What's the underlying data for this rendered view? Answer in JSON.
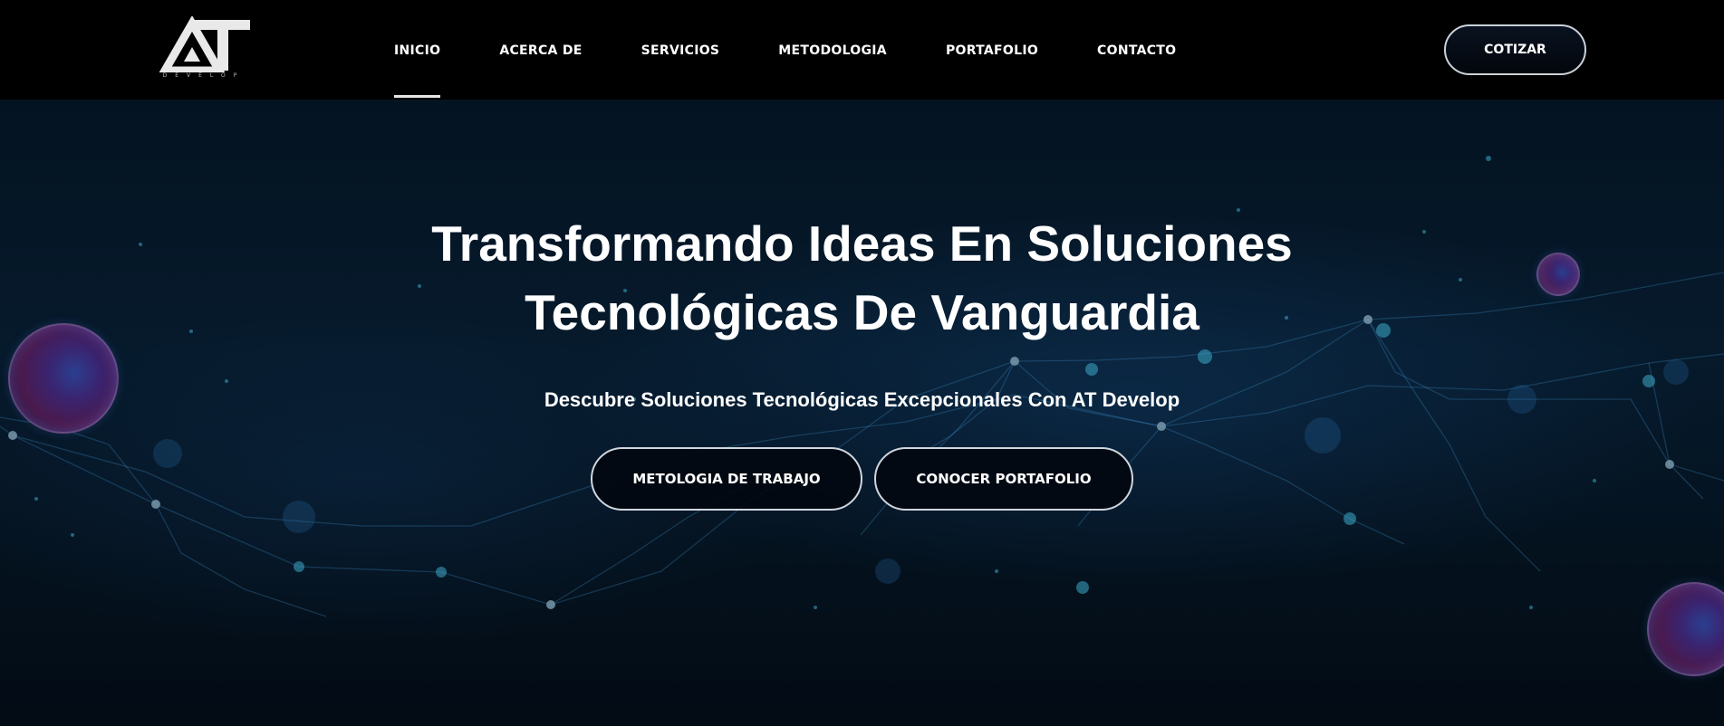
{
  "header": {
    "logo_text": "AT",
    "logo_subtext": "DEVELOP",
    "nav": [
      {
        "label": "INICIO",
        "active": true
      },
      {
        "label": "ACERCA DE",
        "active": false
      },
      {
        "label": "SERVICIOS",
        "active": false
      },
      {
        "label": "METODOLOGIA",
        "active": false
      },
      {
        "label": "PORTAFOLIO",
        "active": false
      },
      {
        "label": "CONTACTO",
        "active": false
      }
    ],
    "cta_label": "COTIZAR"
  },
  "hero": {
    "title_line1": "Transformando Ideas En Soluciones",
    "title_line2": "Tecnológicas De Vanguardia",
    "subtitle": "Descubre Soluciones Tecnológicas Excepcionales Con AT Develop",
    "buttons": [
      {
        "label": "METOLOGIA DE TRABAJO"
      },
      {
        "label": "CONOCER PORTAFOLIO"
      }
    ]
  },
  "colors": {
    "header_bg": "#000000",
    "hero_bg": "#061a2c",
    "text": "#ffffff",
    "button_border": "#cfd6dd"
  }
}
